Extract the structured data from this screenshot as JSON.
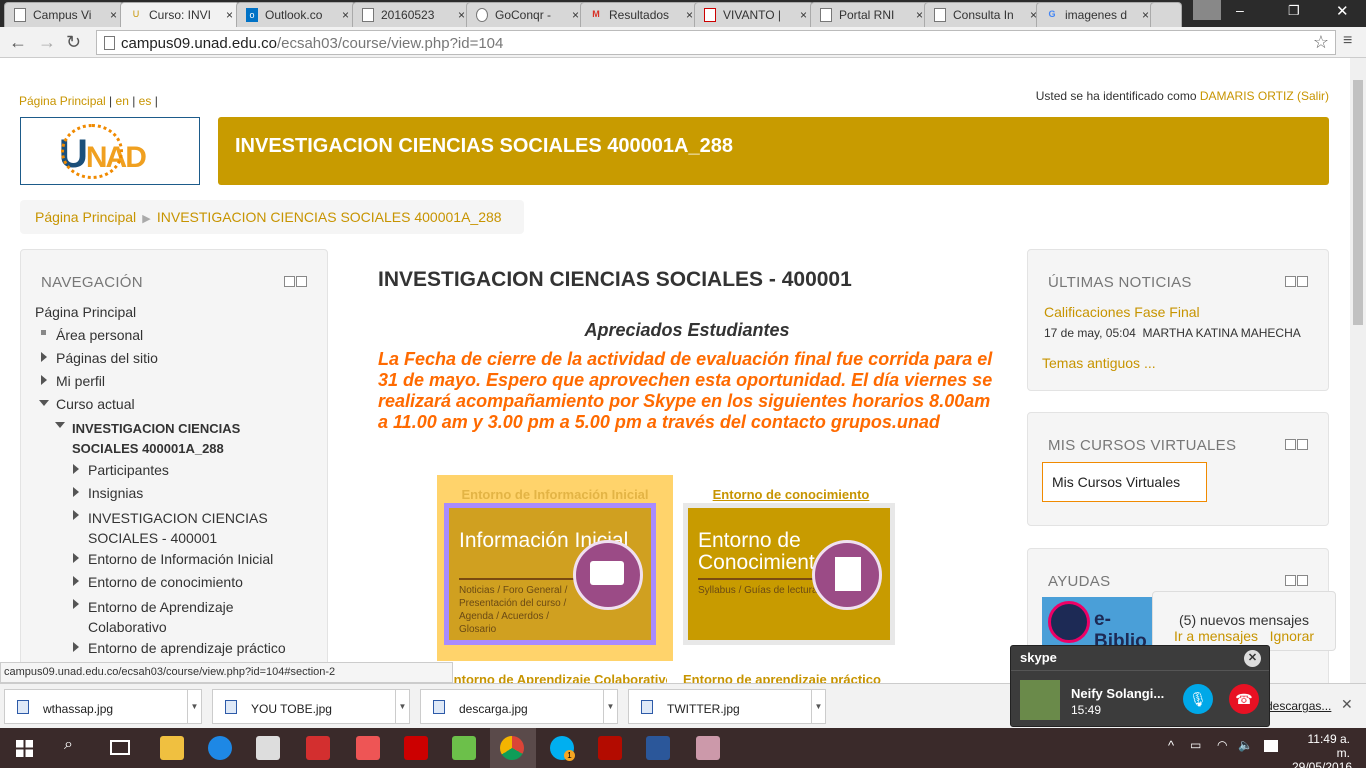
{
  "browser": {
    "tabs": [
      {
        "label": "Campus Vi",
        "active": false
      },
      {
        "label": "Curso: INVI",
        "active": true
      },
      {
        "label": "Outlook.co",
        "active": false
      },
      {
        "label": "20160523",
        "active": false
      },
      {
        "label": "GoConqr -",
        "active": false
      },
      {
        "label": "Resultados",
        "active": false
      },
      {
        "label": "VIVANTO |",
        "active": false
      },
      {
        "label": "Portal RNI",
        "active": false
      },
      {
        "label": "Consulta In",
        "active": false
      },
      {
        "label": "imagenes d",
        "active": false
      }
    ],
    "url_host": "campus09.unad.edu.co",
    "url_path": "/ecsah03/course/view.php?id=104",
    "status_url": "campus09.unad.edu.co/ecsah03/course/view.php?id=104#section-2"
  },
  "header": {
    "lang_links": [
      "Página Principal",
      "en",
      "es"
    ],
    "logged_prefix": "Usted se ha identificado como",
    "user": "DAMARIS ORTIZ",
    "logout": "(Salir)",
    "logo_text": "UNAD",
    "course_banner": "INVESTIGACION CIENCIAS SOCIALES 400001A_288"
  },
  "breadcrumb": [
    "Página Principal",
    "INVESTIGACION CIENCIAS SOCIALES 400001A_288"
  ],
  "navigation": {
    "title": "NAVEGACIÓN",
    "items": [
      "Página Principal",
      "Área personal",
      "Páginas del sitio",
      "Mi perfil",
      "Curso actual",
      "INVESTIGACION CIENCIAS SOCIALES 400001A_288",
      "Participantes",
      "Insignias",
      "INVESTIGACION CIENCIAS SOCIALES - 400001",
      "Entorno de Información Inicial",
      "Entorno de conocimiento",
      "Entorno de Aprendizaje Colaborativo",
      "Entorno de aprendizaje práctico"
    ]
  },
  "main": {
    "title": "INVESTIGACION CIENCIAS SOCIALES - 400001",
    "greeting": "Apreciados Estudiantes",
    "notice": "La Fecha de cierre de la actividad de evaluación final fue corrida para el 31 de mayo. Espero que aprovechen esta oportunidad. El día viernes se realizará acompañamiento por Skype en los siguientes horarios 8.00am a 11.00 am y 3.00 pm a 5.00 pm a través del contacto grupos.unad",
    "sections": [
      {
        "link": "Entorno de Información Inicial",
        "card_title": "Información Inicial",
        "card_sub": "Noticias / Foro General / Presentación del curso / Agenda / Acuerdos / Glosario"
      },
      {
        "link": "Entorno de conocimiento",
        "card_title": "Entorno de Conocimiento",
        "card_sub": "Syllabus / Guías de lectura"
      },
      {
        "link": "Entorno de Aprendizaje Colaborativo"
      },
      {
        "link": "Entorno de aprendizaje práctico"
      }
    ]
  },
  "news": {
    "title": "ÚLTIMAS NOTICIAS",
    "item": "Calificaciones Fase Final",
    "meta": "17 de may, 05:04",
    "author": "MARTHA KATINA MAHECHA",
    "older": "Temas antiguos ..."
  },
  "courses": {
    "title": "MIS CURSOS VIRTUALES",
    "button": "Mis Cursos Virtuales"
  },
  "help": {
    "title": "AYUDAS",
    "banner": "e-Biblio"
  },
  "messages": {
    "count_text": "(5) nuevos mensajes",
    "goto": "Ir a mensajes",
    "ignore": "Ignorar"
  },
  "downloads": {
    "files": [
      "wthassap.jpg",
      "YOU TOBE.jpg",
      "descarga.jpg",
      "TWITTER.jpg"
    ],
    "show_all": "descargas..."
  },
  "skype": {
    "brand": "skype",
    "contact": "Neify Solangi...",
    "duration": "15:49"
  },
  "taskbar": {
    "time": "11:49 a. m.",
    "date": "29/05/2016",
    "skype_badge": "1"
  },
  "colors": {
    "accent": "#c79400",
    "banner": "#c89b00",
    "notice": "#ff6a00"
  }
}
